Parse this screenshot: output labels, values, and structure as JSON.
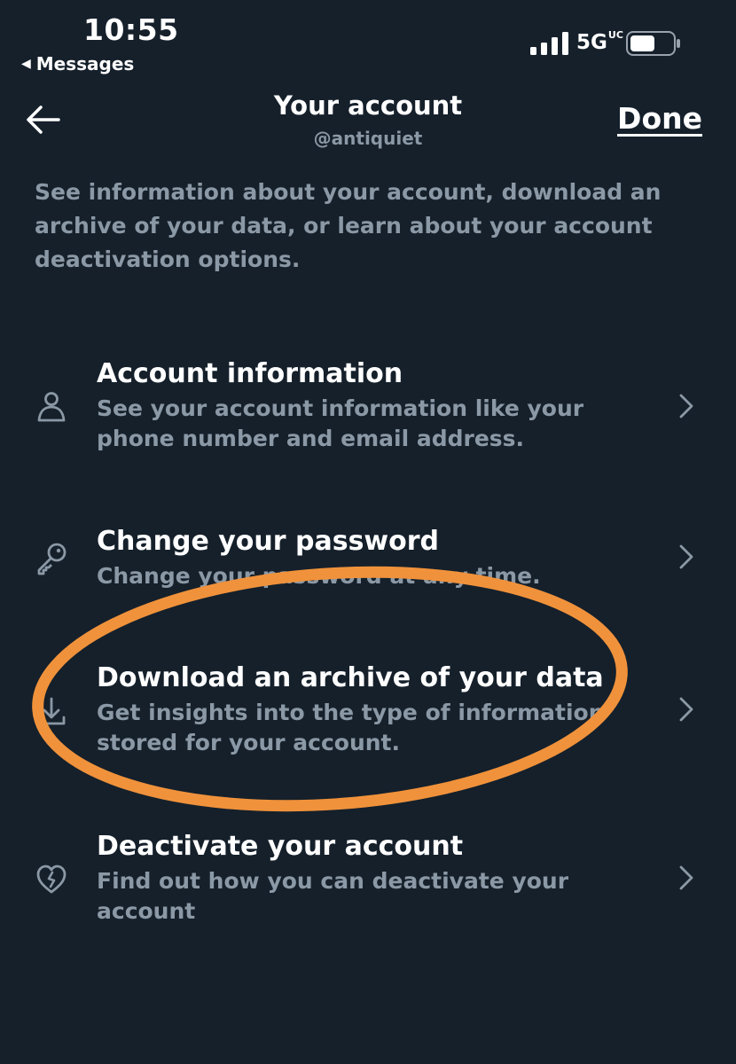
{
  "status_bar": {
    "time": "10:55",
    "back_app": "Messages",
    "network": "5G",
    "network_badge": "UC"
  },
  "header": {
    "title": "Your account",
    "handle": "@antiquiet",
    "done_label": "Done",
    "back_icon": "arrow-left-icon"
  },
  "intro": "See information about your account, download an archive of your data, or learn about your account deactivation options.",
  "items": [
    {
      "title": "Account information",
      "description": "See your account information like your phone number and email address.",
      "icon": "person-icon"
    },
    {
      "title": "Change your password",
      "description": "Change your password at any time.",
      "icon": "key-icon"
    },
    {
      "title": "Download an archive of your data",
      "description": "Get insights into the type of information stored for your account.",
      "icon": "download-icon"
    },
    {
      "title": "Deactivate your account",
      "description": "Find out how you can deactivate your account",
      "icon": "broken-heart-icon"
    }
  ],
  "colors": {
    "background": "#15202b",
    "primary_text": "#ffffff",
    "secondary_text": "#8b98a5",
    "highlight_annotation": "#f0923b"
  }
}
